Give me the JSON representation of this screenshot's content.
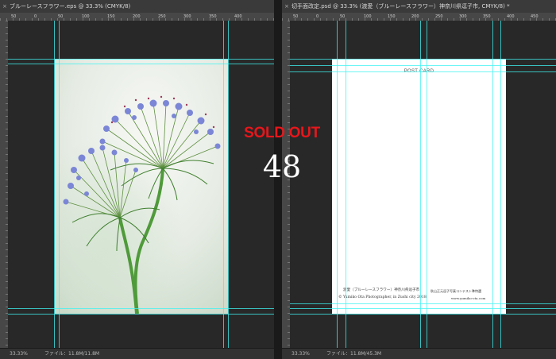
{
  "left_document": {
    "tab_title": "ブルーレースフラワー.eps @ 33.3% (CMYK/8)",
    "close_glyph": "×",
    "ruler_numbers": [
      "50",
      "0",
      "50",
      "100",
      "150",
      "200",
      "250",
      "300",
      "350",
      "400"
    ],
    "status_zoom": "33.33%",
    "status_file": "ファイル：11.8M/11.8M"
  },
  "right_document": {
    "tab_title": "切手面改定.psd @ 33.3% (渡愛（ブルーレースフラワー）神奈川県逗子市, CMYK/8) *",
    "close_glyph": "×",
    "ruler_numbers": [
      "50",
      "0",
      "50",
      "100",
      "150",
      "200",
      "250",
      "300",
      "350",
      "400",
      "450"
    ],
    "status_zoom": "33.33%",
    "status_file": "ファイル：11.8M/45.3M"
  },
  "overlay": {
    "sold_out": "SOLD OUT",
    "number": "48"
  },
  "postcard": {
    "title": "POST CARD",
    "caption_line1_left": "渡愛（ブルーレースフラワー）神奈川県逗子市",
    "caption_line1_right": "秋山正元逗子写真コンテスト準特選",
    "caption_line2_left": "© Yumiko Ota Photographer, in Zushi city 2018",
    "caption_line2_right": "www.yumiko-ota.com"
  },
  "colors": {
    "guide": "#3ff2f2",
    "sold_out": "#e8161b",
    "pasteboard": "#282828"
  }
}
